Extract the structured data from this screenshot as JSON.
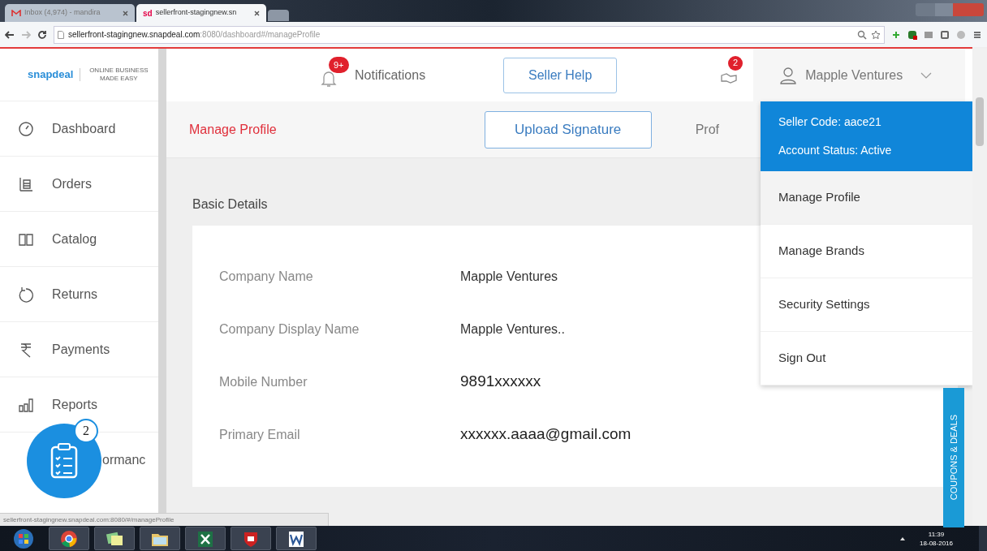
{
  "browser": {
    "tabs": [
      {
        "label": "Inbox (4,974) - mandira",
        "selected": false,
        "kind": "mail"
      },
      {
        "label": "sellerfront-stagingnew.sn",
        "selected": true,
        "kind": "site",
        "favicon": "sd"
      }
    ],
    "address": {
      "host": "sellerfront-stagingnew.snapdeal.com",
      "path": ":8080/dashboard#/manageProfile"
    }
  },
  "header": {
    "logo": "snapdeal",
    "tagline": "ONLINE BUSINESS MADE EASY",
    "notifications": {
      "label": "Notifications",
      "badge": "9+"
    },
    "help_button": "Seller Help",
    "deals_badge": "2",
    "account": "Mapple Ventures"
  },
  "sidebar": {
    "items": [
      {
        "label": "Dashboard"
      },
      {
        "label": "Orders"
      },
      {
        "label": "Catalog"
      },
      {
        "label": "Returns"
      },
      {
        "label": "Payments"
      },
      {
        "label": "Reports"
      },
      {
        "label": "ormanc"
      }
    ]
  },
  "toolbar": {
    "title": "Manage Profile",
    "upload_button": "Upload Signature",
    "cut_tab": "Prof"
  },
  "basic_details": {
    "title": "Basic Details",
    "rows": [
      {
        "label": "Company Name",
        "value": "Mapple Ventures",
        "kind": "plain"
      },
      {
        "label": "Company Display Name",
        "value": "Mapple Ventures..",
        "kind": "plain"
      },
      {
        "label": "Mobile Number",
        "value": "9891xxxxxx",
        "kind": "large"
      },
      {
        "label": "Primary Email",
        "value": "xxxxxx.aaaa@gmail.com",
        "kind": "large"
      }
    ]
  },
  "account_menu": {
    "seller_code": "Seller Code: aace21",
    "account_status": "Account Status: Active",
    "items": [
      {
        "label": "Manage Profile",
        "selected": true
      },
      {
        "label": "Manage Brands",
        "selected": false
      },
      {
        "label": "Security Settings",
        "selected": false
      },
      {
        "label": "Sign Out",
        "selected": false
      }
    ]
  },
  "task_button": {
    "badge": "2"
  },
  "side_tab": "COUPONS & DEALS",
  "status_bar": "sellerfront-stagingnew.snapdeal.com:8080/#/manageProfile",
  "taskbar": {
    "time": "11:39",
    "date": "18-08-2016"
  }
}
